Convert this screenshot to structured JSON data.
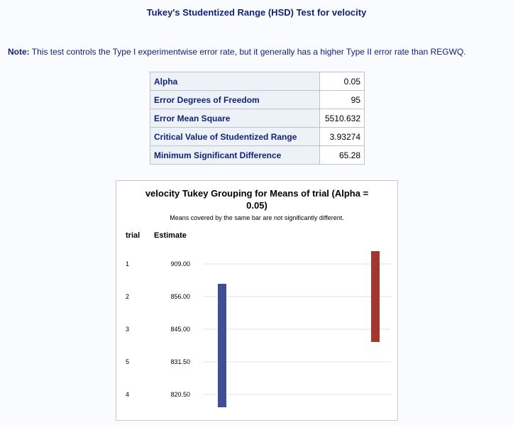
{
  "page": {
    "title": "Tukey's Studentized Range (HSD) Test for velocity",
    "note_label": "Note:",
    "note_text": " This test controls the Type I experimentwise error rate, but it generally has a higher Type II error rate than REGWQ."
  },
  "stats_table": {
    "rows": [
      {
        "label": "Alpha",
        "value": "0.05"
      },
      {
        "label": "Error Degrees of Freedom",
        "value": "95"
      },
      {
        "label": "Error Mean Square",
        "value": "5510.632"
      },
      {
        "label": "Critical Value of Studentized Range",
        "value": "3.93274"
      },
      {
        "label": "Minimum Significant Difference",
        "value": "65.28"
      }
    ]
  },
  "chart_data": {
    "type": "table",
    "title": "velocity Tukey Grouping for Means of trial (Alpha = 0.05)",
    "subtitle": "Means covered by the same bar are not significantly different.",
    "columns": [
      "trial",
      "Estimate"
    ],
    "rows": [
      {
        "trial": "1",
        "estimate": "909.00"
      },
      {
        "trial": "2",
        "estimate": "856.00"
      },
      {
        "trial": "3",
        "estimate": "845.00"
      },
      {
        "trial": "5",
        "estimate": "831.50"
      },
      {
        "trial": "4",
        "estimate": "820.50"
      }
    ],
    "groups": [
      {
        "from_row": 1,
        "to_row": 4,
        "color": "#3f4f97"
      },
      {
        "from_row": 0,
        "to_row": 2,
        "color": "#a1372f"
      }
    ],
    "grid": true
  }
}
